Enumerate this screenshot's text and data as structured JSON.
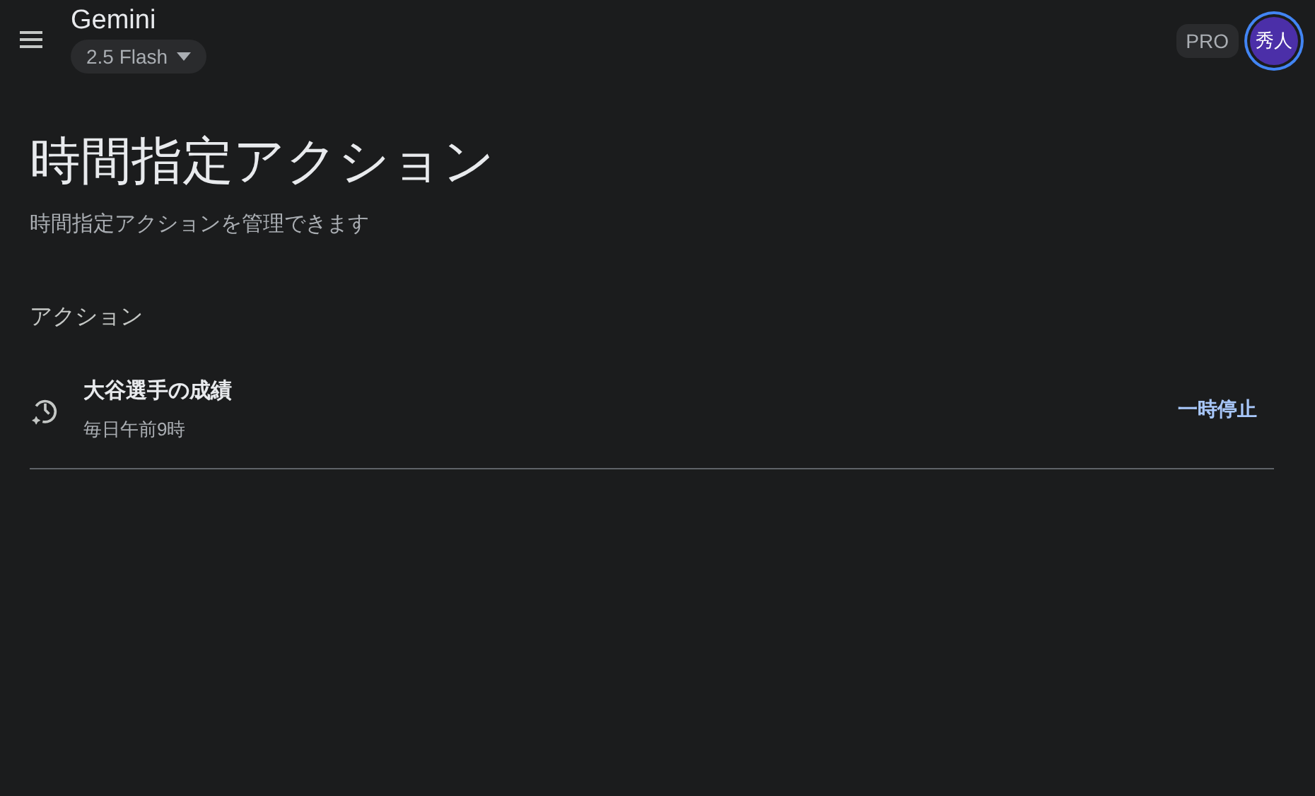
{
  "header": {
    "title": "Gemini",
    "model": "2.5 Flash",
    "plan": "PRO",
    "avatar": "秀人"
  },
  "page": {
    "title": "時間指定アクション",
    "subtitle": "時間指定アクションを管理できます",
    "section": "アクション"
  },
  "actions": [
    {
      "title": "大谷選手の成績",
      "schedule": "毎日午前9時",
      "button": "一時停止"
    }
  ]
}
